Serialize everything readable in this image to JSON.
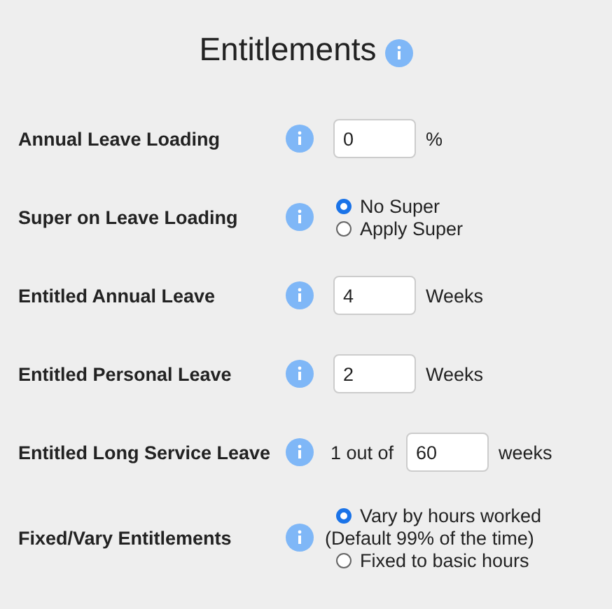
{
  "title": "Entitlements",
  "rows": [
    {
      "kind": "input",
      "label": "Annual Leave Loading",
      "value": "0",
      "suffix": "%"
    },
    {
      "kind": "radio",
      "label": "Super on Leave Loading",
      "options": [
        {
          "label": "No Super",
          "selected": true
        },
        {
          "label": "Apply Super",
          "selected": false
        }
      ]
    },
    {
      "kind": "input",
      "label": "Entitled Annual Leave",
      "value": "4",
      "suffix": "Weeks"
    },
    {
      "kind": "input",
      "label": "Entitled Personal Leave",
      "value": "2",
      "suffix": "Weeks"
    },
    {
      "kind": "input",
      "label": "Entitled Long Service Leave",
      "prefix": "1 out of",
      "value": "60",
      "suffix": "weeks"
    },
    {
      "kind": "radio",
      "label": "Fixed/Vary Entitlements",
      "options": [
        {
          "label": "Vary by hours worked",
          "selected": true,
          "note": "(Default 99% of the time)"
        },
        {
          "label": "Fixed to basic hours",
          "selected": false
        }
      ]
    }
  ]
}
